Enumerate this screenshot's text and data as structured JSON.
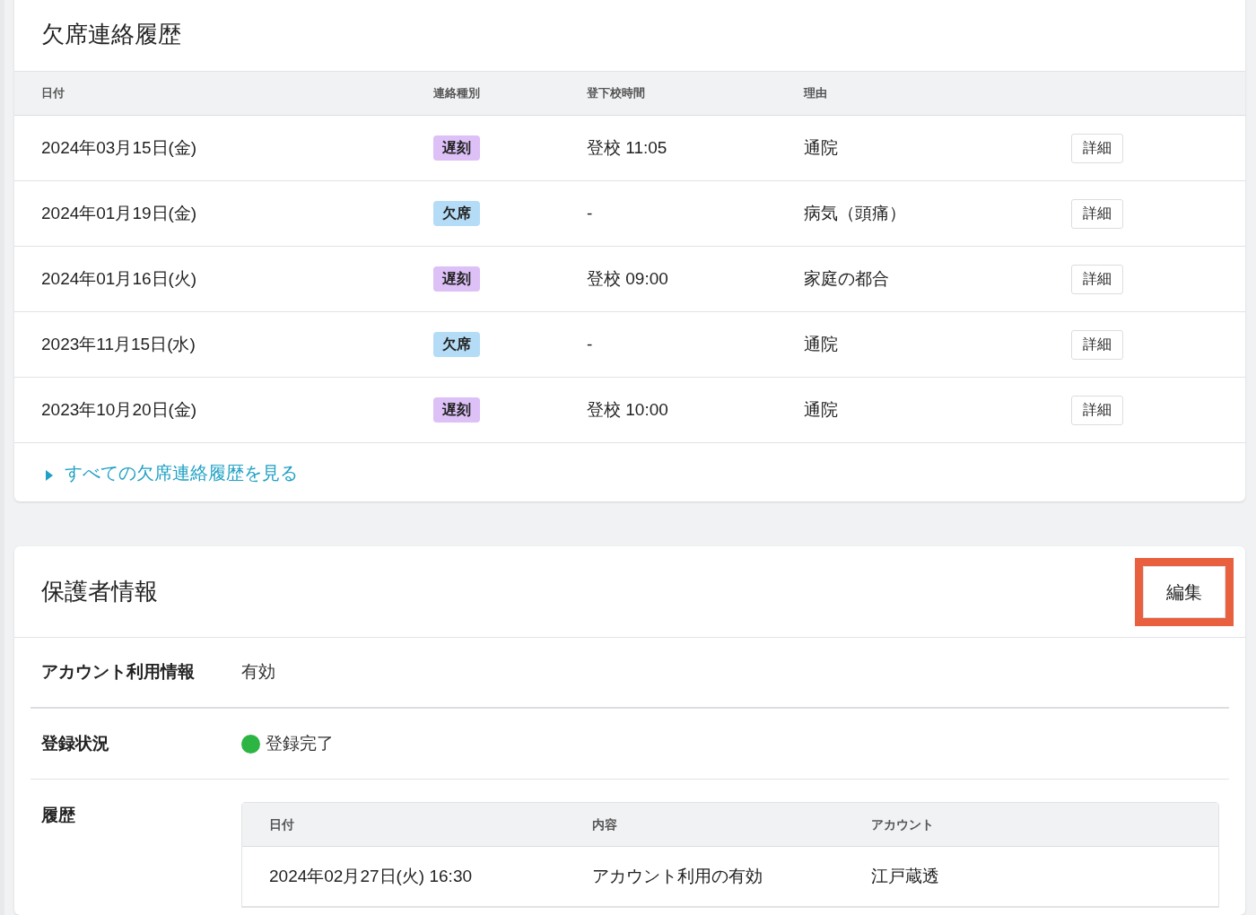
{
  "absence_history": {
    "title": "欠席連絡履歴",
    "columns": [
      "日付",
      "連絡種別",
      "登下校時間",
      "理由"
    ],
    "rows": [
      {
        "date": "2024年03月15日(金)",
        "type": {
          "label": "遅刻",
          "kind": "late"
        },
        "time": "登校 11:05",
        "reason": "通院",
        "action": "詳細"
      },
      {
        "date": "2024年01月19日(金)",
        "type": {
          "label": "欠席",
          "kind": "absent"
        },
        "time": "-",
        "reason": "病気（頭痛）",
        "action": "詳細"
      },
      {
        "date": "2024年01月16日(火)",
        "type": {
          "label": "遅刻",
          "kind": "late"
        },
        "time": "登校 09:00",
        "reason": "家庭の都合",
        "action": "詳細"
      },
      {
        "date": "2023年11月15日(水)",
        "type": {
          "label": "欠席",
          "kind": "absent"
        },
        "time": "-",
        "reason": "通院",
        "action": "詳細"
      },
      {
        "date": "2023年10月20日(金)",
        "type": {
          "label": "遅刻",
          "kind": "late"
        },
        "time": "登校 10:00",
        "reason": "通院",
        "action": "詳細"
      }
    ],
    "more_link": "すべての欠席連絡履歴を見る"
  },
  "guardian_info": {
    "title": "保護者情報",
    "edit_button": {
      "label": "編集",
      "highlighted": true
    },
    "fields": [
      {
        "label": "アカウント利用情報",
        "value": "有効"
      },
      {
        "label": "登録状況",
        "value": "登録完了",
        "color": "#2db543"
      }
    ],
    "history": {
      "label": "履歴",
      "columns": [
        "日付",
        "内容",
        "アカウント"
      ],
      "rows": [
        {
          "date": "2024年02月27日(火) 16:30",
          "content": "アカウント利用の有効",
          "account": "江戸蔵透"
        }
      ]
    }
  }
}
